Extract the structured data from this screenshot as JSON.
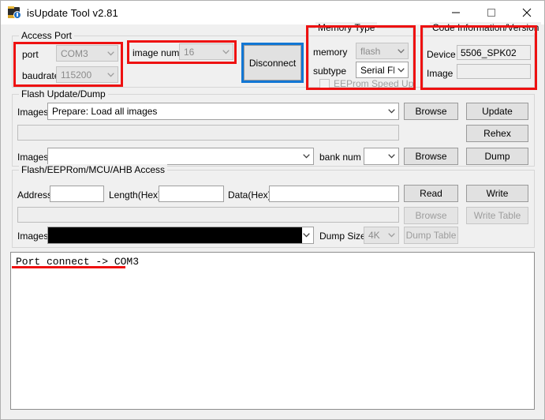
{
  "window": {
    "title": "isUpdate Tool v2.81",
    "icon": "app-icon",
    "controls": {
      "minimize": "minimize-icon",
      "maximize": "maximize-icon",
      "close": "close-icon"
    }
  },
  "access_port": {
    "title": "Access Port",
    "port_label": "port",
    "port_value": "COM3",
    "baudrate_label": "baudrate",
    "baudrate_value": "115200",
    "image_num_label": "image num",
    "image_num_value": "16",
    "connect_button": "Disconnect"
  },
  "memory_type": {
    "title": "Memory Type",
    "memory_label": "memory",
    "memory_value": "flash",
    "subtype_label": "subtype",
    "subtype_value": "Serial Flas",
    "eeprom_speed_up_label": "EEProm Speed Up"
  },
  "code_info": {
    "title": "Code Information/Version",
    "device_label": "Device",
    "device_value": "5506_SPK02",
    "image_label": "Image",
    "image_value": ""
  },
  "flash_update": {
    "title": "Flash Update/Dump",
    "images1_label": "Images",
    "images1_value": "Prepare: Load all images",
    "progress_value": "",
    "images2_label": "Images",
    "images2_value": "",
    "bank_num_label": "bank num",
    "bank_num_value": "",
    "browse1_button": "Browse",
    "browse2_button": "Browse",
    "update_button": "Update",
    "rehex_button": "Rehex",
    "dump_button": "Dump"
  },
  "access": {
    "title": "Flash/EEPRom/MCU/AHB Access",
    "address_label": "Address",
    "address_value": "",
    "length_label": "Length(Hex)",
    "length_value": "",
    "data_label": "Data(Hex)",
    "data_value": "",
    "progress_value": "",
    "images_label": "Images",
    "images_value": "",
    "dump_size_label": "Dump Size",
    "dump_size_value": "4K",
    "read_button": "Read",
    "write_button": "Write",
    "browse_button": "Browse",
    "write_table_button": "Write Table",
    "dump_table_button": "Dump Table"
  },
  "log": {
    "line1": "Port connect -> COM3"
  },
  "annotations": {
    "highlight_red": "#ee1111",
    "highlight_blue": "#1277d4"
  }
}
